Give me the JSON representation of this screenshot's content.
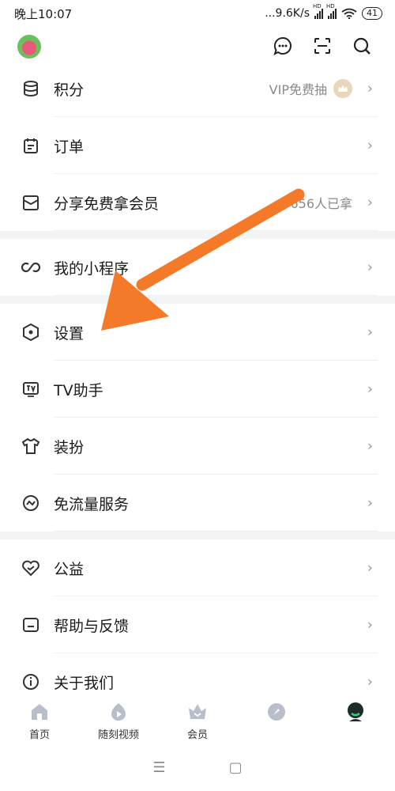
{
  "status_bar": {
    "time": "晚上10:07",
    "network_speed": "...9.6K/s",
    "hd_label": "HD",
    "battery": "41"
  },
  "header": {
    "icons": [
      "message-icon",
      "scan-icon",
      "search-icon"
    ]
  },
  "menu": {
    "groups": [
      [
        {
          "label": "积分",
          "extra": "VIP免费抽",
          "icon": "coins-icon"
        },
        {
          "label": "订单",
          "extra": "",
          "icon": "order-icon"
        },
        {
          "label": "分享免费拿会员",
          "extra": "656人已拿",
          "icon": "share-icon"
        }
      ],
      [
        {
          "label": "我的小程序",
          "extra": "",
          "icon": "mini-program-icon"
        }
      ],
      [
        {
          "label": "设置",
          "extra": "",
          "icon": "settings-icon"
        },
        {
          "label": "TV助手",
          "extra": "",
          "icon": "tv-icon"
        },
        {
          "label": "装扮",
          "extra": "",
          "icon": "shirt-icon"
        },
        {
          "label": "免流量服务",
          "extra": "",
          "icon": "traffic-icon"
        }
      ],
      [
        {
          "label": "公益",
          "extra": "",
          "icon": "charity-icon"
        },
        {
          "label": "帮助与反馈",
          "extra": "",
          "icon": "feedback-icon"
        },
        {
          "label": "关于我们",
          "extra": "",
          "icon": "info-icon"
        }
      ]
    ],
    "chevron": "›"
  },
  "bottom_nav": [
    {
      "label": "首页",
      "icon": "home-icon"
    },
    {
      "label": "随刻视频",
      "icon": "video-icon"
    },
    {
      "label": "会员",
      "icon": "vip-crown-icon"
    },
    {
      "label": "",
      "icon": "discover-icon"
    },
    {
      "label": "",
      "icon": "profile-icon"
    }
  ],
  "system_bar": {
    "menu_glyph": "☰",
    "home_glyph": "▢"
  },
  "colors": {
    "accent_orange": "#f47a2a",
    "gap_bg": "#f3f4f6",
    "text_gray": "#8a8a8a",
    "nav_gray": "#b8bfcb"
  }
}
